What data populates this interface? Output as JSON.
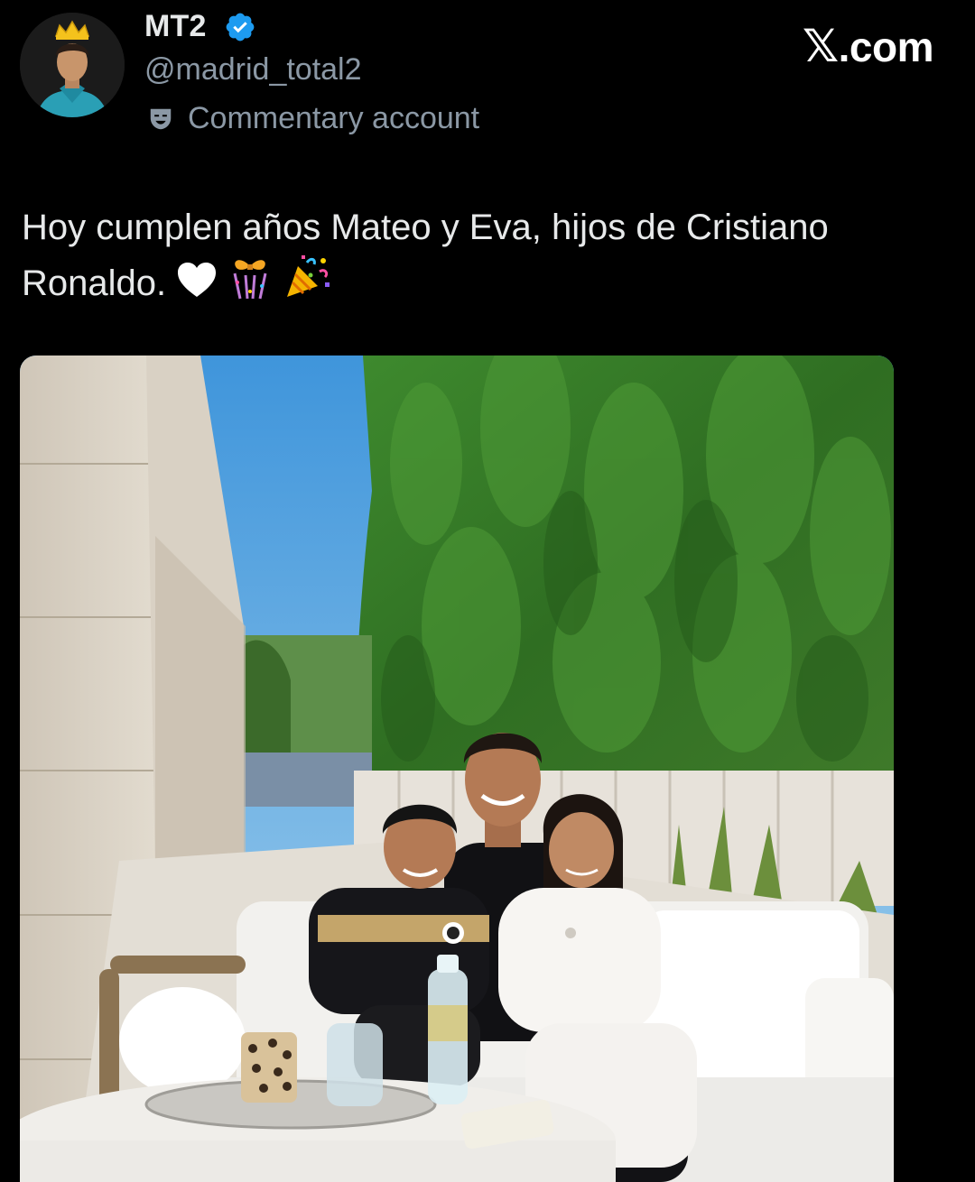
{
  "author": {
    "display_name": "MT2",
    "handle": "@madrid_total2",
    "verified": true,
    "account_label": "Commentary account",
    "avatar_icon": "profile-photo-crowned-player",
    "label_icon": "theater-mask-icon"
  },
  "watermark": {
    "text": ".com",
    "glyph": "𝕏"
  },
  "post": {
    "text": "Hoy cumplen años Mateo y Eva, hijos de Cristiano Ronaldo.",
    "emojis": [
      "white-heart",
      "ribbon-gift",
      "confetti-ball",
      "party-popper"
    ]
  },
  "media": {
    "type": "photo",
    "scene": "family-on-patio-sofa"
  },
  "colors": {
    "background": "#000000",
    "primary_text": "#e7e9ea",
    "secondary_text": "#8b98a5",
    "verified_blue": "#1d9bf0"
  }
}
